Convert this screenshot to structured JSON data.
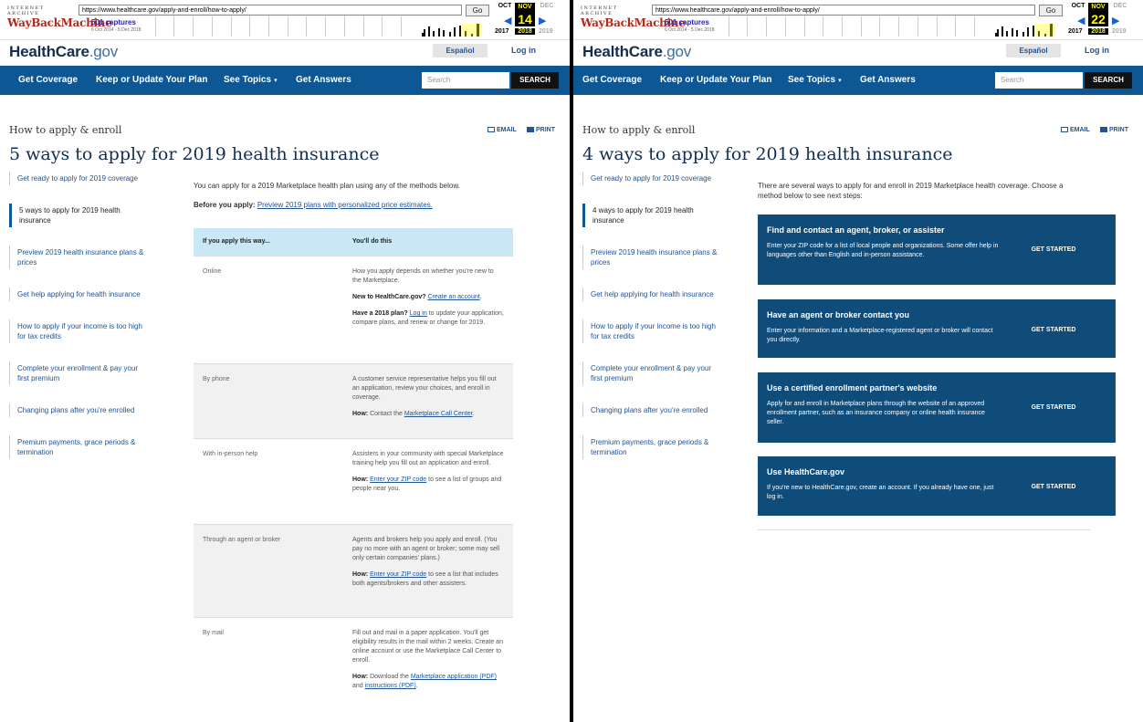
{
  "wayback": {
    "ia_label": "INTERNET ARCHIVE",
    "logo_label": "WayBackMachine",
    "go_label": "Go",
    "captures_label": "501 captures",
    "range_label": "6 Oct 2014 - 5 Dec 2018",
    "months": [
      "OCT",
      "NOV",
      "DEC"
    ],
    "years": [
      "2017",
      "2018",
      "2019"
    ],
    "day_left": "14",
    "day_right": "22",
    "url": "https://www.healthcare.gov/apply-and-enroll/how-to-apply/"
  },
  "header": {
    "logo_main": "HealthCare",
    "logo_suffix": ".gov",
    "espanol_label": "Español",
    "login_label": "Log in"
  },
  "nav": {
    "items": [
      "Get Coverage",
      "Keep or Update Your Plan",
      "See Topics",
      "Get Answers"
    ],
    "search_placeholder": "Search",
    "search_button": "SEARCH"
  },
  "breadcrumb": "How to apply & enroll",
  "email_label": "EMAIL",
  "print_label": "PRINT",
  "left": {
    "title": "5 ways to apply for 2019 health insurance",
    "sidenav": [
      "Get ready to apply for 2019 coverage",
      "5 ways to apply for 2019 health insurance",
      "Preview 2019 health insurance plans & prices",
      "Get help applying for health insurance",
      "How to apply if your income is too high for tax credits",
      "Complete your enrollment & pay your first premium",
      "Changing plans after you're enrolled",
      "Premium payments, grace periods & termination"
    ],
    "intro": "You can apply for a 2019 Marketplace health plan using any of the methods below.",
    "before_label": "Before you apply:",
    "before_link": "Preview 2019 plans with personalized price estimates.",
    "table": {
      "col1": "If you apply this way...",
      "col2": "You'll do this",
      "rows": [
        {
          "method": "Online",
          "p1": "How you apply depends on whether you're new to the Marketplace.",
          "p2_bold": "New to HealthCare.gov?",
          "p2_link": "Create an account",
          "p2_end": ".",
          "p3_bold": "Have a 2018 plan?",
          "p3_link": "Log in",
          "p3_end": "to update your application, compare plans, and renew or change for 2019."
        },
        {
          "method": "By phone",
          "p1": "A customer service representative helps you fill out an application, review your choices, and enroll in coverage.",
          "how_label": "How:",
          "how_pre": "Contact the",
          "how_link": "Marketplace Call Center",
          "how_end": "."
        },
        {
          "method": "With in-person help",
          "p1": "Assisters in your community with special Marketplace training help you fill out an application and enroll.",
          "how_label": "How:",
          "how_link": "Enter your ZIP code",
          "how_end": "to see a list of groups and people near you."
        },
        {
          "method": "Through an agent or broker",
          "p1": "Agents and brokers help you apply and enroll. (You pay no more with an agent or broker; some may sell only certain companies' plans.)",
          "how_label": "How:",
          "how_link": "Enter your ZIP code",
          "how_end": "to see a list that includes both agents/brokers and other assisters."
        },
        {
          "method": "By mail",
          "p1": "Fill out and mail in a paper application. You'll get eligibility results in the mail within 2 weeks. Create an online account or use the Marketplace Call Center to enroll.",
          "how_label": "How:",
          "how_pre": "Download the",
          "how_link": "Marketplace application (PDF)",
          "how_mid": "and",
          "how_link2": "instructions (PDF)",
          "how_end": "."
        }
      ]
    }
  },
  "right": {
    "title": "4 ways to apply for 2019 health insurance",
    "sidenav": [
      "Get ready to apply for 2019 coverage",
      "4 ways to apply for 2019 health insurance",
      "Preview 2019 health insurance plans & prices",
      "Get help applying for health insurance",
      "How to apply if your income is too high for tax credits",
      "Complete your enrollment & pay your first premium",
      "Changing plans after you're enrolled",
      "Premium payments, grace periods & termination"
    ],
    "intro": "There are several ways to apply for and enroll in 2019 Marketplace health coverage. Choose a method below to see next steps:",
    "cards": [
      {
        "title": "Find and contact an agent, broker, or assister",
        "body": "Enter your ZIP code for a list of local people and organizations. Some offer help in languages other than English and in-person assistance.",
        "button": "GET STARTED"
      },
      {
        "title": "Have an agent or broker contact you",
        "body": "Enter your information and a Marketplace-registered agent or broker will contact you directly.",
        "button": "GET STARTED"
      },
      {
        "title": "Use a certified enrollment partner's website",
        "body": "Apply for and enroll in Marketplace plans through the website of an approved enrollment partner, such as an insurance company or online health insurance seller.",
        "button": "GET STARTED"
      },
      {
        "title": "Use HealthCare.gov",
        "body": "If you're new to HealthCare.gov, create an account. If you already have one, just log in.",
        "button": "GET STARTED"
      }
    ]
  }
}
